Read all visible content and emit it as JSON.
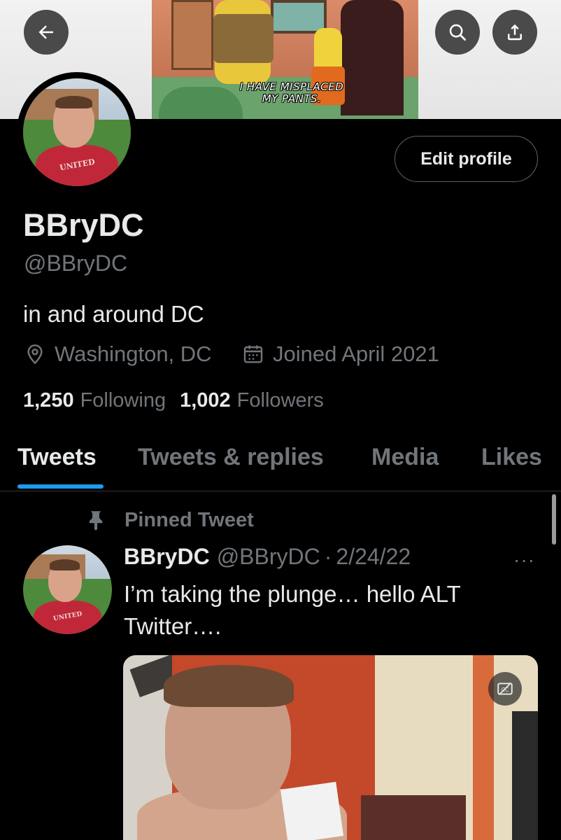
{
  "banner": {
    "caption_line1": "I HAVE MISPLACED",
    "caption_line2": "MY PANTS."
  },
  "header_icons": {
    "back": "arrow-left-icon",
    "search": "search-icon",
    "share": "share-icon"
  },
  "profile": {
    "edit_button": "Edit profile",
    "display_name": "BBryDC",
    "handle": "@BBryDC",
    "bio": "in and around DC",
    "location": "Washington, DC",
    "joined": "Joined April 2021",
    "avatar_shirt_text": "UNITED",
    "following_count": "1,250",
    "following_label": "Following",
    "followers_count": "1,002",
    "followers_label": "Followers"
  },
  "tabs": [
    {
      "label": "Tweets",
      "active": true
    },
    {
      "label": "Tweets & replies",
      "active": false
    },
    {
      "label": "Media",
      "active": false
    },
    {
      "label": "Likes",
      "active": false
    }
  ],
  "pinned_tweet": {
    "pinned_label": "Pinned Tweet",
    "name": "BBryDC",
    "handle": "@BBryDC",
    "separator": "·",
    "date": "2/24/22",
    "more": "···",
    "text": "I’m taking the plunge… hello ALT Twitter….",
    "media_badge": "CC"
  },
  "colors": {
    "background": "#000000",
    "text_primary": "#e7e9ea",
    "text_secondary": "#71767b",
    "accent": "#1d9bf0",
    "border": "#2f3336"
  }
}
